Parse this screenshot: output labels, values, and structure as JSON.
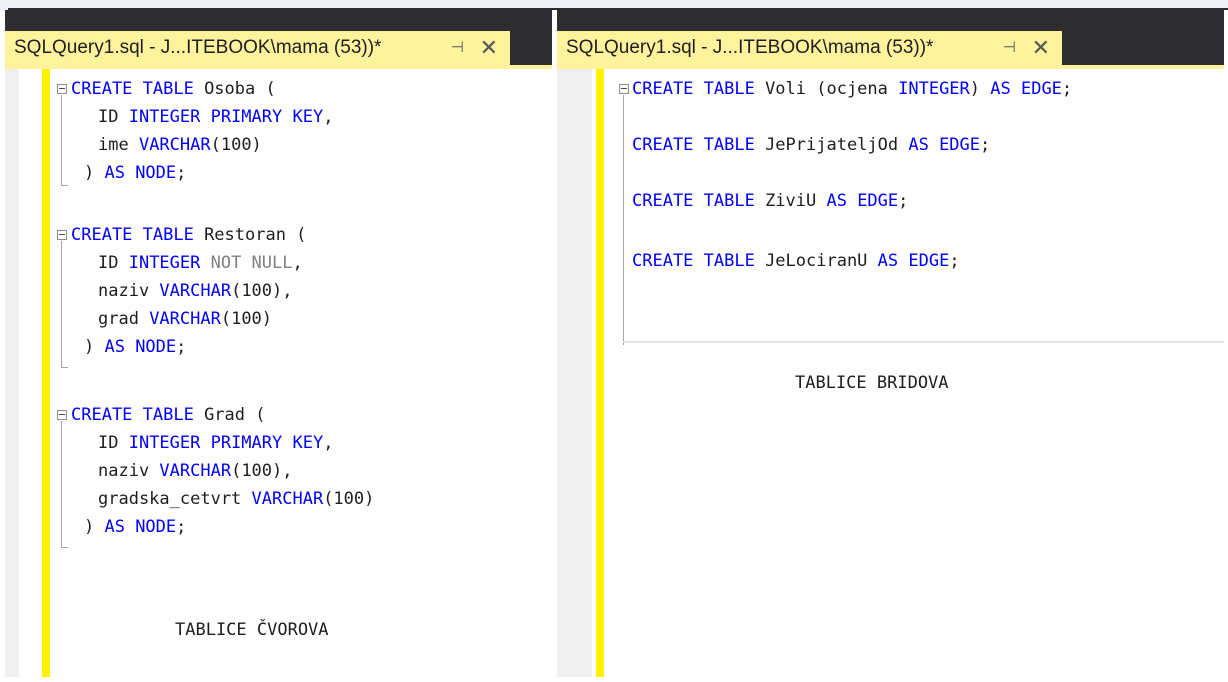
{
  "left_tab": {
    "title": "SQLQuery1.sql - J...ITEBOOK\\mama (53))*",
    "pin_icon": "⊣",
    "close_icon": "✕"
  },
  "right_tab": {
    "title": "SQLQuery1.sql - J...ITEBOOK\\mama (53))*",
    "pin_icon": "⊣",
    "close_icon": "✕"
  },
  "left_code": {
    "osoba": {
      "l1_kw": "CREATE TABLE",
      "l1_txt": " Osoba (",
      "l2_a": "ID ",
      "l2_kw": "INTEGER PRIMARY KEY",
      "l2_b": ",",
      "l3_a": "ime ",
      "l3_kw": "VARCHAR",
      "l3_b": "(100)",
      "l4_a": ") ",
      "l4_kw": "AS NODE",
      "l4_b": ";"
    },
    "restoran": {
      "l1_kw": "CREATE TABLE",
      "l1_txt": " Restoran (",
      "l2_a": "ID ",
      "l2_kw": "INTEGER",
      "l2_gray": " NOT NULL",
      "l2_b": ",",
      "l3_a": "naziv ",
      "l3_kw": "VARCHAR",
      "l3_b": "(100),",
      "l4_a": "grad ",
      "l4_kw": "VARCHAR",
      "l4_b": "(100)",
      "l5_a": ") ",
      "l5_kw": "AS NODE",
      "l5_b": ";"
    },
    "grad": {
      "l1_kw": "CREATE TABLE",
      "l1_txt": " Grad (",
      "l2_a": "ID ",
      "l2_kw": "INTEGER PRIMARY KEY",
      "l2_b": ",",
      "l3_a": "naziv ",
      "l3_kw": "VARCHAR",
      "l3_b": "(100),",
      "l4_a": "gradska_cetvrt ",
      "l4_kw": "VARCHAR",
      "l4_b": "(100)",
      "l5_a": ") ",
      "l5_kw": "AS NODE",
      "l5_b": ";"
    },
    "caption": "TABLICE ČVOROVA"
  },
  "right_code": {
    "voli": {
      "kw1": "CREATE TABLE",
      "a": " Voli (ocjena ",
      "kw2": "INTEGER",
      "b": ") ",
      "kw3": "AS EDGE",
      "c": ";"
    },
    "prijatelj": {
      "kw1": "CREATE TABLE",
      "a": " JePrijateljOd ",
      "kw3": "AS EDGE",
      "c": ";"
    },
    "zivi": {
      "kw1": "CREATE TABLE",
      "a": " ZiviU ",
      "kw3": "AS EDGE",
      "c": ";"
    },
    "lociran": {
      "kw1": "CREATE TABLE",
      "a": " JeLociranU ",
      "kw3": "AS EDGE",
      "c": ";"
    },
    "caption": "TABLICE BRIDOVA"
  }
}
